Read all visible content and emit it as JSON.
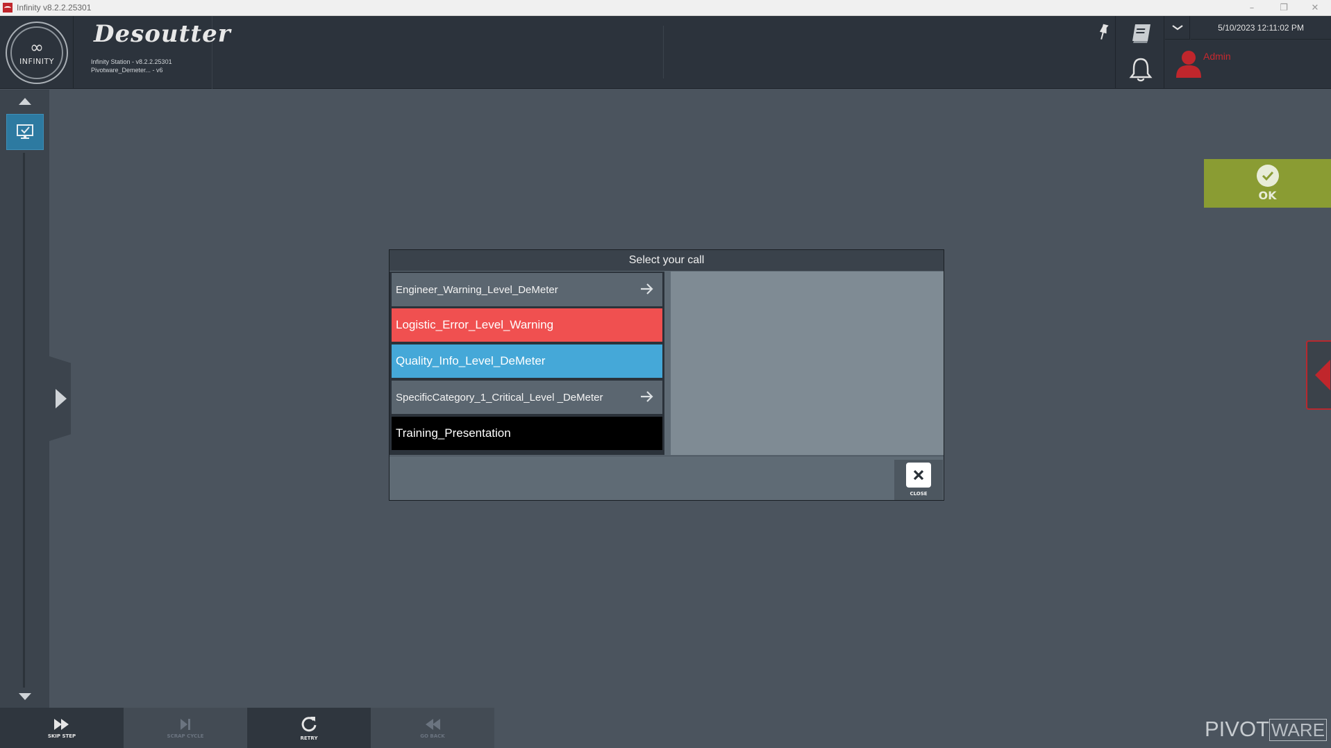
{
  "window": {
    "title": "Infinity v8.2.2.25301",
    "minimize": "–",
    "restore": "❐",
    "close": "✕"
  },
  "header": {
    "infinity_logo_text": "INFINITY",
    "brand": "Desoutter",
    "station_line": "Infinity Station - v8.2.2.25301",
    "project_line": "Pivotware_Demeter... - v6",
    "datetime": "5/10/2023 12:11:02 PM",
    "user": "Admin",
    "icons": [
      "pin-icon",
      "book-icon",
      "bell-icon",
      "chevron-down-icon",
      "user-icon"
    ]
  },
  "ok_button": {
    "label": "OK",
    "color": "#8a9c33"
  },
  "dialog": {
    "title": "Select your call",
    "calls": [
      {
        "label": "Engineer_Warning_Level_DeMeter",
        "color": "#5b6670",
        "has_arrow": true
      },
      {
        "label": "Logistic_Error_Level_Warning",
        "color": "#f05050",
        "has_arrow": false
      },
      {
        "label": "Quality_Info_Level_DeMeter",
        "color": "#45a8d8",
        "has_arrow": false
      },
      {
        "label": "SpecificCategory_1_Critical_Level _DeMeter",
        "color": "#5b6670",
        "has_arrow": true
      },
      {
        "label": "Training_Presentation",
        "color": "#000000",
        "has_arrow": false
      }
    ],
    "close_label": "CLOSE"
  },
  "bottom_toolbar": [
    {
      "label": "SKIP STEP",
      "icon": "fast-forward-icon",
      "enabled": true
    },
    {
      "label": "SCRAP CYCLE",
      "icon": "skip-end-icon",
      "enabled": false
    },
    {
      "label": "RETRY",
      "icon": "retry-icon",
      "enabled": true
    },
    {
      "label": "GO BACK",
      "icon": "rewind-icon",
      "enabled": false
    }
  ],
  "footer_logo": {
    "part1": "PIVOT",
    "part2": "WARE"
  }
}
